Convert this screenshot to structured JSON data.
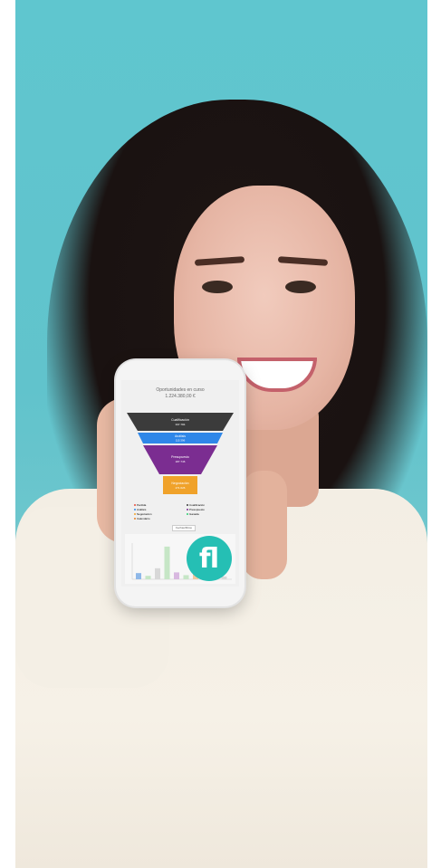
{
  "screen": {
    "title": "Oportunidades en curso",
    "total": "1.224.380,00 €",
    "funnel": [
      {
        "label": "Cualificación",
        "value": "337.784",
        "color": "#3b3b3b"
      },
      {
        "label": "Análisis",
        "value": "115.396",
        "color": "#2f87e8"
      },
      {
        "label": "Presupuesto",
        "value": "187.746",
        "color": "#7b2d91"
      },
      {
        "label": "Negociación",
        "value": "271.626",
        "color": "#f0a22a"
      }
    ],
    "legend_left": [
      "Perdida",
      "Análisis",
      "Negociación",
      "Calendario"
    ],
    "legend_right": [
      "Cualificación",
      "Presupuesto",
      "Ganada"
    ],
    "filter_button": "Fechas/filtros",
    "bar_values": [
      0.18,
      0.1,
      0.32,
      0.95,
      0.2,
      0.12,
      0.26,
      0.15,
      0.3,
      0.08
    ]
  },
  "logo": {
    "text": "fl",
    "color": "#25bfb4"
  }
}
